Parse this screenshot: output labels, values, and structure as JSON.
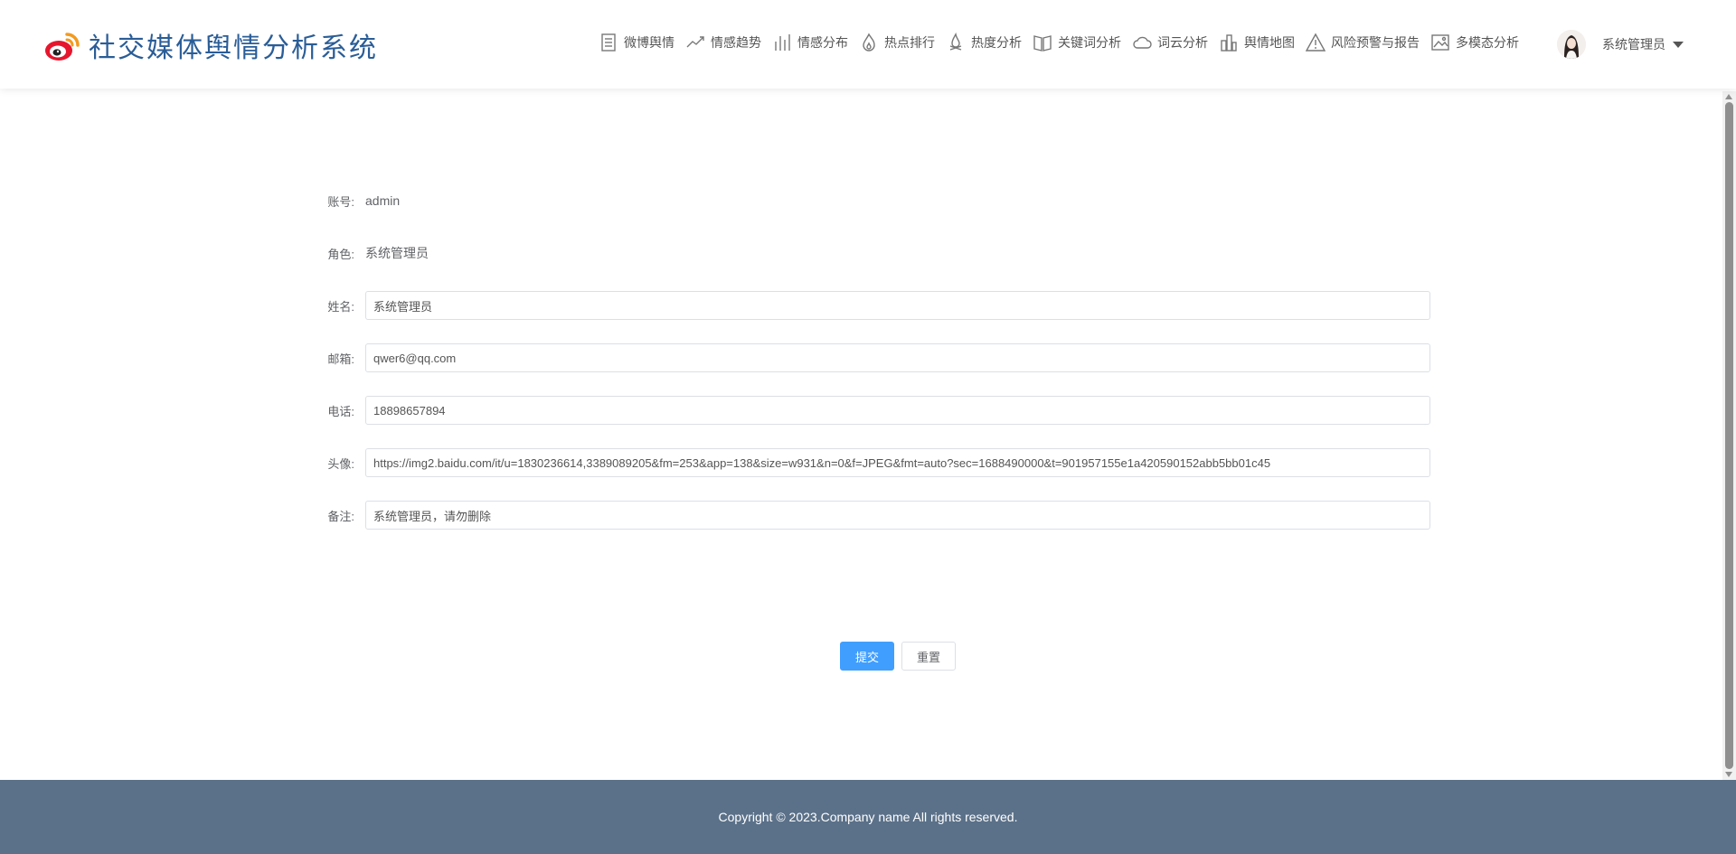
{
  "app": {
    "title": "社交媒体舆情分析系统",
    "brand_color": "#2a5d97",
    "logo_icon": "weibo-logo-icon"
  },
  "nav": {
    "items": [
      {
        "label": "微博舆情",
        "icon": "document-icon"
      },
      {
        "label": "情感趋势",
        "icon": "trend-line-icon"
      },
      {
        "label": "情感分布",
        "icon": "bar-chart-icon"
      },
      {
        "label": "热点排行",
        "icon": "flame-icon"
      },
      {
        "label": "热度分析",
        "icon": "fire-icon"
      },
      {
        "label": "关键词分析",
        "icon": "book-icon"
      },
      {
        "label": "词云分析",
        "icon": "cloud-icon"
      },
      {
        "label": "舆情地图",
        "icon": "buildings-icon"
      },
      {
        "label": "风险预警与报告",
        "icon": "warning-icon"
      },
      {
        "label": "多模态分析",
        "icon": "image-icon"
      }
    ]
  },
  "user": {
    "name": "系统管理员"
  },
  "form": {
    "account": {
      "label": "账号:",
      "value": "admin"
    },
    "role": {
      "label": "角色:",
      "value": "系统管理员"
    },
    "name": {
      "label": "姓名:",
      "value": "系统管理员"
    },
    "email": {
      "label": "邮箱:",
      "value": "qwer6@qq.com"
    },
    "phone": {
      "label": "电话:",
      "value": "18898657894"
    },
    "avatar": {
      "label": "头像:",
      "value": "https://img2.baidu.com/it/u=1830236614,3389089205&fm=253&app=138&size=w931&n=0&f=JPEG&fmt=auto?sec=1688490000&t=901957155e1a420590152abb5bb01c45"
    },
    "remark": {
      "label": "备注:",
      "value": "系统管理员，请勿删除"
    }
  },
  "buttons": {
    "submit": "提交",
    "reset": "重置",
    "primary_color": "#409eff"
  },
  "footer": {
    "text": "Copyright © 2023.Company name All rights reserved.",
    "bg_color": "#5b7189"
  }
}
